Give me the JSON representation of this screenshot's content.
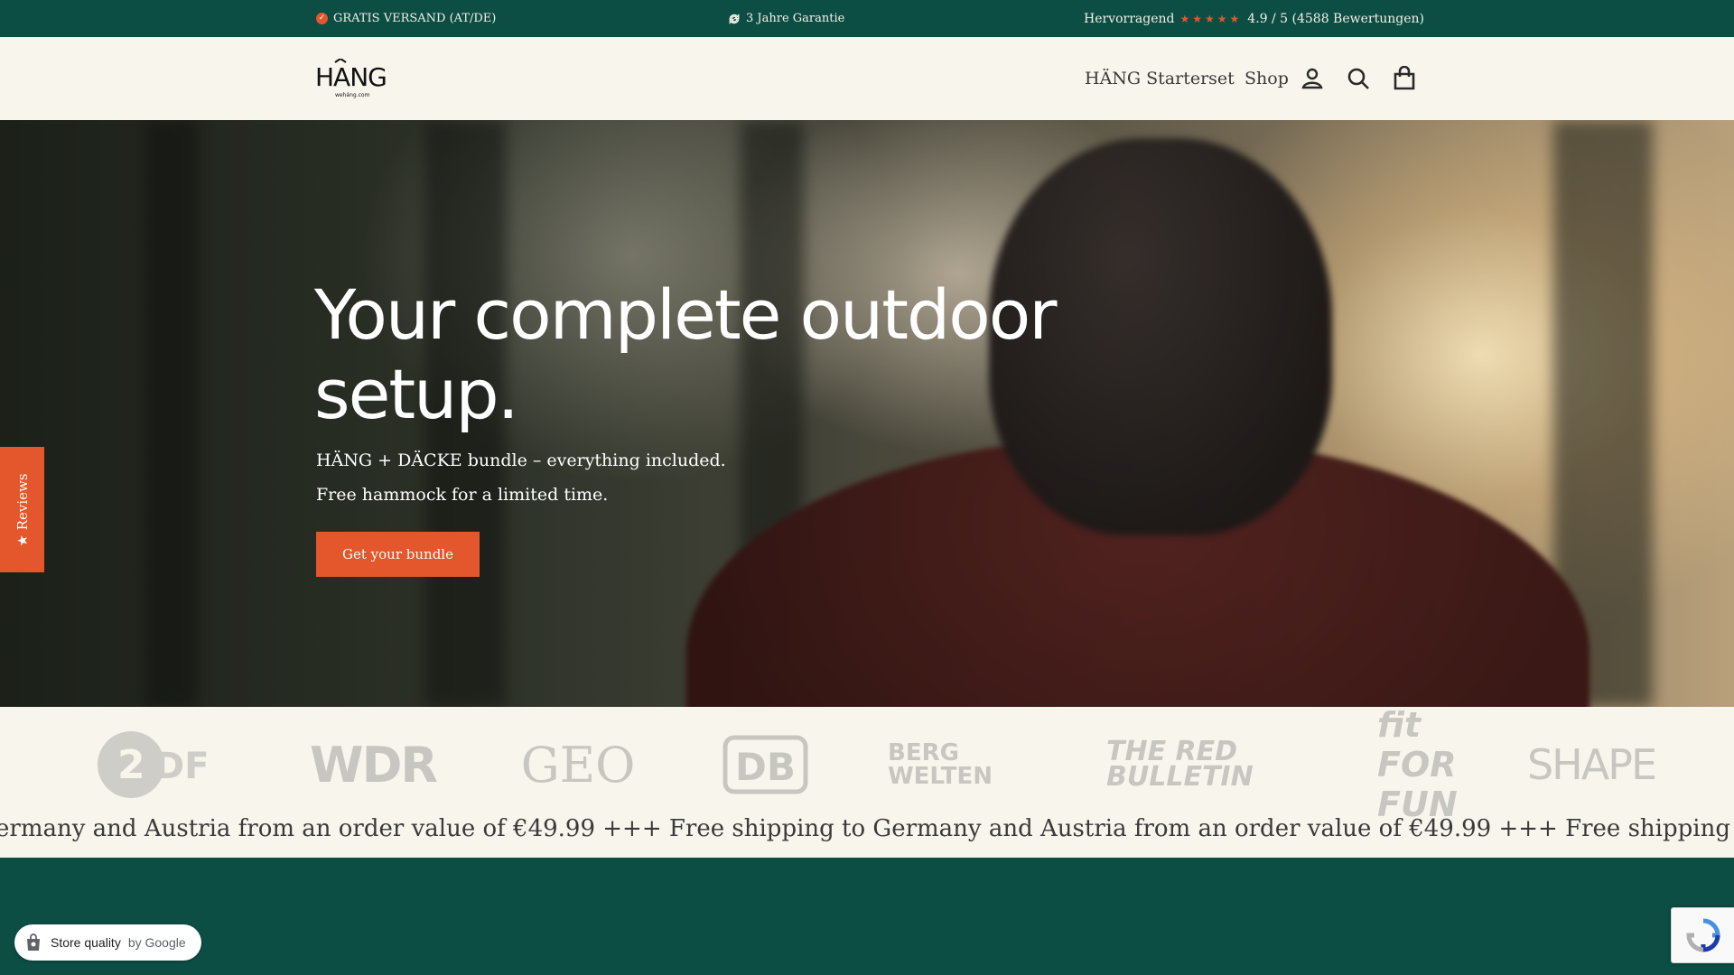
{
  "topbar": {
    "shipping": "GRATIS VERSAND (AT/DE)",
    "warranty": "3 Jahre Garantie",
    "rating_label": "Hervorragend",
    "rating_stars": "★★★★★",
    "rating_value": "4.9 / 5 (4588 Bewertungen)"
  },
  "header": {
    "logo_text": "HÄNG",
    "logo_url": "wehang.com",
    "nav": [
      "HÄNG Starterset",
      "Shop"
    ]
  },
  "hero": {
    "title": "Your complete outdoor setup.",
    "subtitle1": "HÄNG + DÄCKE bundle – everything included.",
    "subtitle2": "Free hammock for a limited time.",
    "button": "Get your bundle"
  },
  "reviews_tab": "★ Reviews",
  "press_logos": [
    "2DF",
    "WDR",
    "GEO",
    "DB",
    "BERG WELTEN",
    "THE RED BULLETIN",
    "fit FOR FUN",
    "SHAPE"
  ],
  "marquee": "ermany and Austria from an order value of €49.99 +++ Free shipping to Germany and Austria from an order value of €49.99 +++ Free shipping to Germany",
  "google_badge": {
    "label": "Store quality",
    "by": "by Google"
  },
  "colors": {
    "brand_green": "#0c4e44",
    "accent_orange": "#e4562b",
    "cream": "#f8f5ec"
  }
}
